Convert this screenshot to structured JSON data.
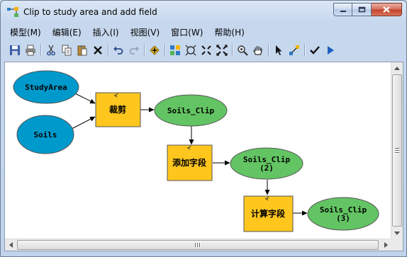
{
  "window": {
    "title": "Clip to study area and add field",
    "icon": "model-builder-icon",
    "controls": [
      "minimize-icon",
      "maximize-icon",
      "close-icon"
    ]
  },
  "menu": [
    {
      "id": "model",
      "label": "模型(M)"
    },
    {
      "id": "edit",
      "label": "编辑(E)"
    },
    {
      "id": "insert",
      "label": "插入(I)"
    },
    {
      "id": "view",
      "label": "视图(V)"
    },
    {
      "id": "window",
      "label": "窗口(W)"
    },
    {
      "id": "help",
      "label": "帮助(H)"
    }
  ],
  "toolbar": [
    "save-icon",
    "print-icon",
    "cut-icon",
    "copy-icon",
    "paste-icon",
    "delete-icon",
    "undo-icon",
    "redo-icon",
    "add-data-icon",
    "auto-layout-icon",
    "full-extent-icon",
    "fixed-zoom-in-icon",
    "fixed-zoom-out-icon",
    "zoom-in-icon",
    "pan-icon",
    "select-icon",
    "connect-icon",
    "validate-icon",
    "run-icon"
  ],
  "colors": {
    "input_data": "#0099cc",
    "tool": "#ffc61e",
    "derived_data": "#63c463",
    "connector": "#000000"
  },
  "diagram": {
    "inputs": [
      {
        "id": "studyarea",
        "label": "StudyArea"
      },
      {
        "id": "soils",
        "label": "Soils"
      }
    ],
    "tools": [
      {
        "id": "clip",
        "label": "裁剪"
      },
      {
        "id": "addfield",
        "label": "添加字段"
      },
      {
        "id": "calcfield",
        "label": "计算字段"
      }
    ],
    "outputs": [
      {
        "id": "soils_clip",
        "line1": "Soils_Clip",
        "line2": ""
      },
      {
        "id": "soils_clip2",
        "line1": "Soils_Clip",
        "line2": "(2)"
      },
      {
        "id": "soils_clip3",
        "line1": "Soils_Clip",
        "line2": "(3)"
      }
    ]
  }
}
